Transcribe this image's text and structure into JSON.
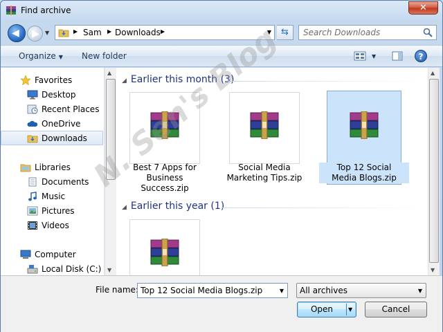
{
  "window": {
    "title": "Find archive",
    "close_label": "✕"
  },
  "address": {
    "crumbs": [
      "Sam",
      "Downloads"
    ]
  },
  "search": {
    "placeholder": "Search Downloads"
  },
  "command_bar": {
    "organize": "Organize",
    "new_folder": "New folder",
    "help": "?"
  },
  "nav_pane": {
    "items": [
      {
        "label": "Favorites",
        "icon": "star-icon"
      },
      {
        "label": "Desktop",
        "icon": "desktop-icon"
      },
      {
        "label": "Recent Places",
        "icon": "recent-places-icon"
      },
      {
        "label": "OneDrive",
        "icon": "onedrive-icon"
      },
      {
        "label": "Downloads",
        "icon": "downloads-folder-icon",
        "selected": true
      },
      {
        "label": "Libraries",
        "icon": "libraries-icon"
      },
      {
        "label": "Documents",
        "icon": "documents-icon"
      },
      {
        "label": "Music",
        "icon": "music-icon"
      },
      {
        "label": "Pictures",
        "icon": "pictures-icon"
      },
      {
        "label": "Videos",
        "icon": "videos-icon"
      },
      {
        "label": "Computer",
        "icon": "computer-icon"
      },
      {
        "label": "Local Disk (C:)",
        "icon": "local-disk-icon"
      }
    ]
  },
  "groups": [
    {
      "header": "Earlier this month (3)",
      "files": [
        {
          "name": "Best 7 Apps for Business Success.zip",
          "lines": [
            "Best 7 Apps for",
            "Business",
            "Success.zip"
          ]
        },
        {
          "name": "Social Media Marketing Tips.zip",
          "lines": [
            "Social Media",
            "Marketing Tips.zip"
          ]
        },
        {
          "name": "Top 12 Social Media Blogs.zip",
          "lines": [
            "Top 12 Social",
            "Media Blogs.zip"
          ],
          "selected": true
        }
      ]
    },
    {
      "header": "Earlier this year (1)",
      "files": [
        {
          "name": "",
          "lines": []
        }
      ]
    }
  ],
  "bottom": {
    "file_name_label": "File name:",
    "file_name_value": "Top 12 Social Media Blogs.zip",
    "filter_value": "All archives",
    "open_label": "Open",
    "cancel_label": "Cancel"
  },
  "watermark": "N. Sen's Blog",
  "colors": {
    "group_header": "#1e3287",
    "selection": "#cce4fb",
    "close_button": "#c13a1f"
  }
}
